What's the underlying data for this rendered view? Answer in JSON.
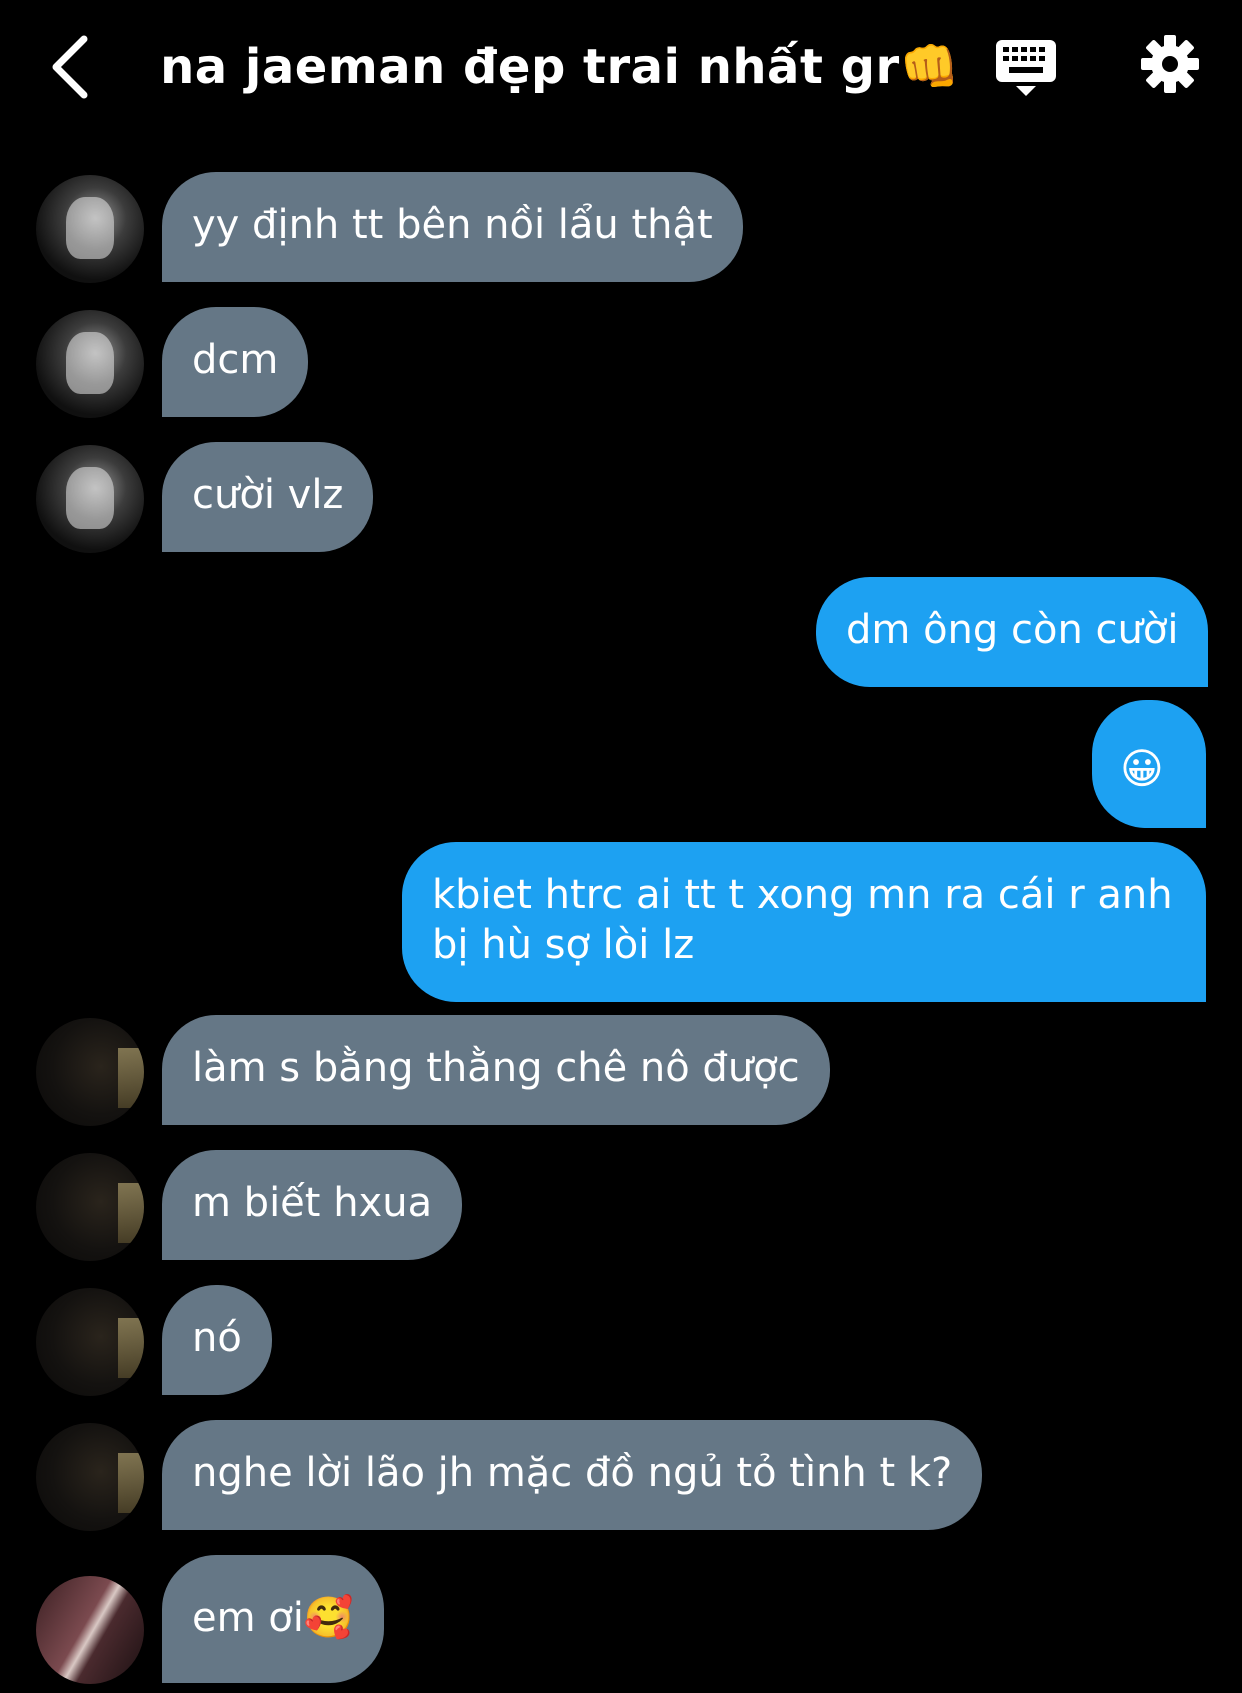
{
  "header": {
    "title": "na jaeman đẹp trai nhất gr👊",
    "back_icon": "chevron-left-icon",
    "keyboard_icon": "keyboard-icon",
    "settings_icon": "gear-icon"
  },
  "colors": {
    "background": "#000000",
    "incoming_bubble": "#657786",
    "outgoing_bubble": "#1da1f2"
  },
  "messages": [
    {
      "direction": "in",
      "avatar": "avatar-a",
      "text": "yy định tt bên nồi lẩu thật"
    },
    {
      "direction": "in",
      "avatar": "avatar-a",
      "text": "dcm"
    },
    {
      "direction": "in",
      "avatar": "avatar-a",
      "text": "cười vlz"
    },
    {
      "direction": "out",
      "text": "dm ông còn cười"
    },
    {
      "direction": "out",
      "text": "😀"
    },
    {
      "direction": "out",
      "text": "kbiet htrc ai tt t xong mn ra cái r anh bị hù sợ lòi lz"
    },
    {
      "direction": "in",
      "avatar": "avatar-b",
      "text": "làm s bằng thằng chê nô được"
    },
    {
      "direction": "in",
      "avatar": "avatar-b",
      "text": "m biết hxua"
    },
    {
      "direction": "in",
      "avatar": "avatar-b",
      "text": "nó"
    },
    {
      "direction": "in",
      "avatar": "avatar-b",
      "text": "nghe lời lão jh mặc đồ ngủ tỏ tình t k?"
    },
    {
      "direction": "in",
      "avatar": "avatar-c",
      "text": "em ơi🥰"
    }
  ]
}
